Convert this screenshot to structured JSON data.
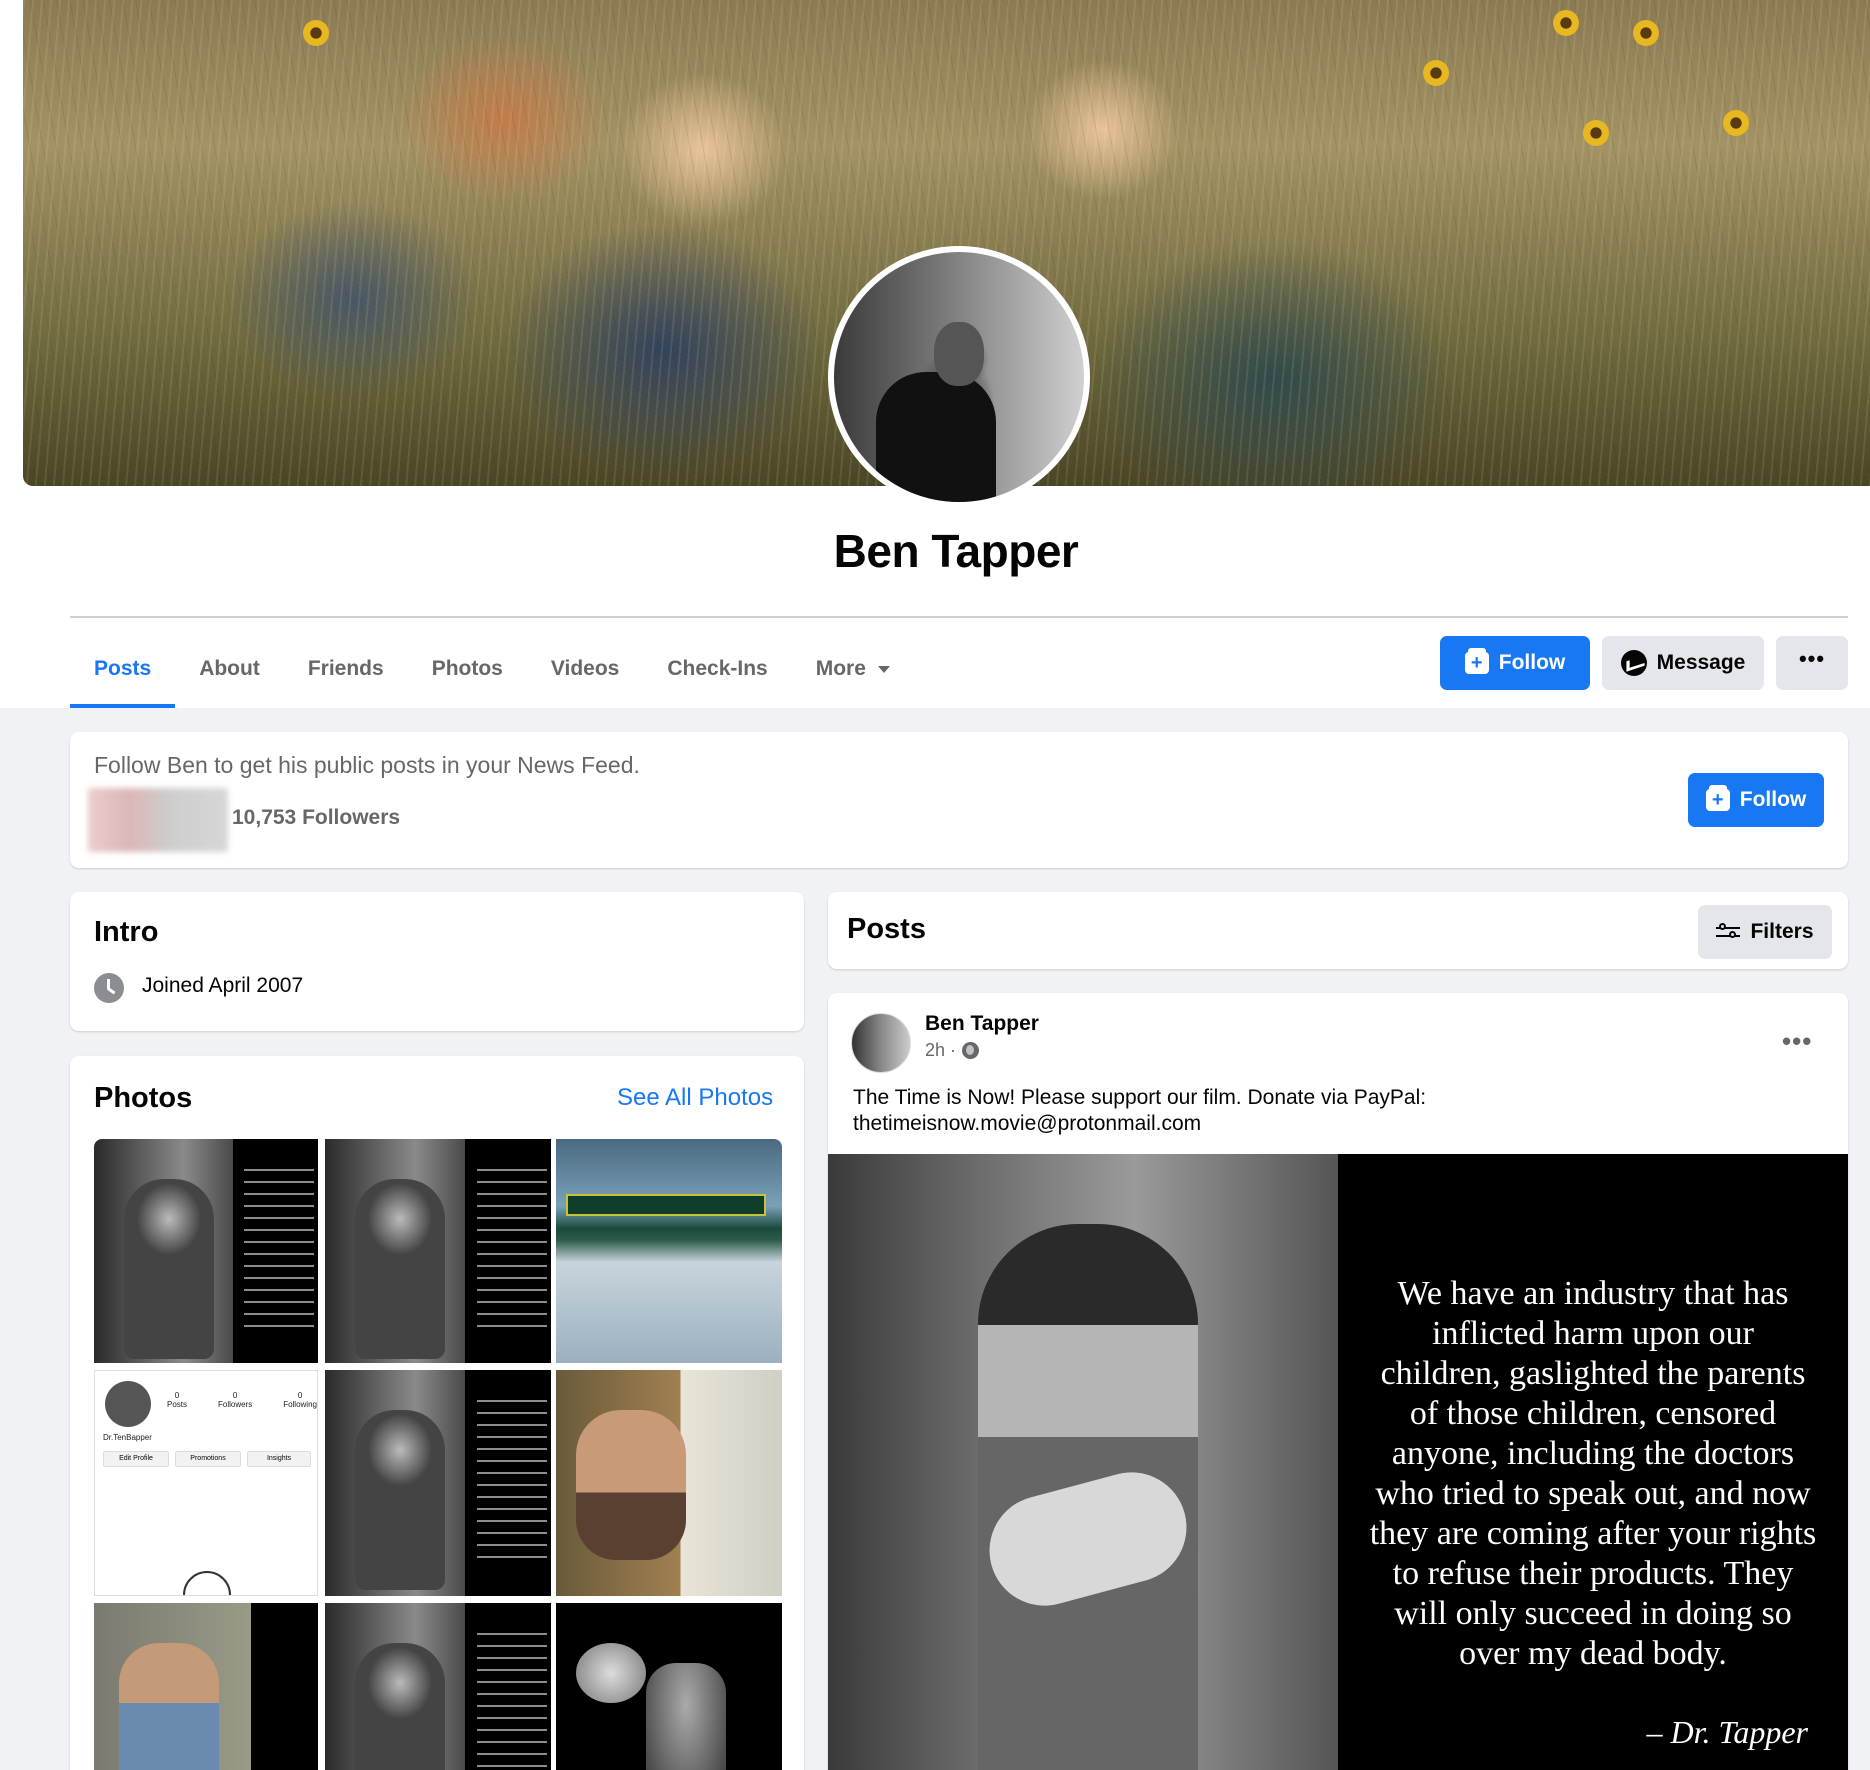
{
  "profile": {
    "name": "Ben Tapper"
  },
  "tabs": [
    {
      "label": "Posts"
    },
    {
      "label": "About"
    },
    {
      "label": "Friends"
    },
    {
      "label": "Photos"
    },
    {
      "label": "Videos"
    },
    {
      "label": "Check-Ins"
    },
    {
      "label": "More"
    }
  ],
  "actions": {
    "follow_label": "Follow",
    "message_label": "Message",
    "more_dots": "•••"
  },
  "follow_banner": {
    "text": "Follow Ben to get his public posts in your News Feed.",
    "followers": "10,753 Followers",
    "follow_label": "Follow"
  },
  "intro": {
    "title": "Intro",
    "joined": "Joined April 2007"
  },
  "photos": {
    "title": "Photos",
    "see_all": "See All Photos",
    "insta_handle": "Dr.TenBapper",
    "insta_stats": [
      "0",
      "0",
      "0"
    ],
    "insta_stat_labels": [
      "Posts",
      "Followers",
      "Following"
    ],
    "insta_buttons": [
      "Edit Profile",
      "Promotions",
      "Insights"
    ]
  },
  "posts_header": {
    "title": "Posts",
    "filters_label": "Filters"
  },
  "post": {
    "author": "Ben Tapper",
    "time": "2h ·",
    "text_line1": "The Time is Now! Please support our film. Donate via PayPal:",
    "text_line2": "thetimeisnow.movie@protonmail.com",
    "quote": "We have an industry that has inflicted harm upon our children, gaslighted the parents of those children, censored anyone, including the doctors who tried to speak out, and now they are coming after your rights to refuse their products. They will only succeed in doing so over my dead body.",
    "signature": "– Dr. Tapper",
    "dots": "•••"
  },
  "colors": {
    "accent": "#1877f2",
    "page_bg": "#f0f2f5",
    "secondary_text": "#65676b"
  }
}
